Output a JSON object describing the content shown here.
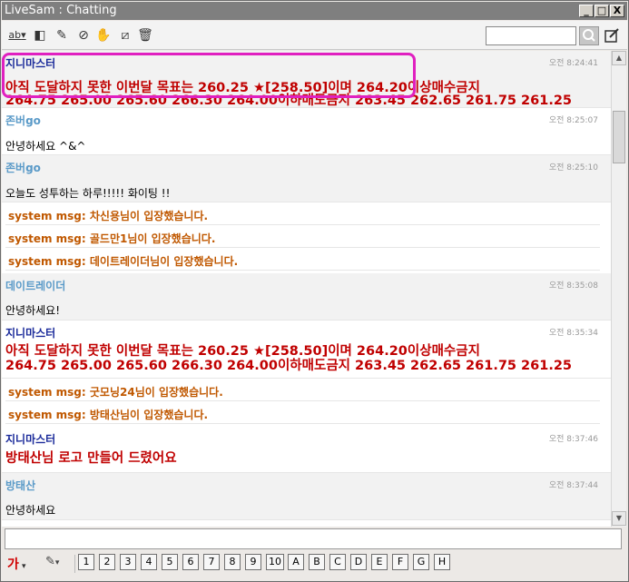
{
  "window": {
    "title": "LiveSam : Chatting",
    "min_label": "_",
    "max_label": "□",
    "close_label": "X"
  },
  "toolbar": {
    "ab_label": "ab",
    "search_placeholder": "",
    "icons": [
      "text-style-icon",
      "layout-icon",
      "eraser-icon",
      "block-icon",
      "mute-icon",
      "hide-icon",
      "trash-icon",
      "search-icon",
      "edit-icon"
    ]
  },
  "chat": {
    "messages": [
      {
        "name": "지니마스터",
        "time": "오전 8:24:41",
        "lines": [
          "아직 도달하지 못한 이번달 목표는 260.25 ★[258.50]이며 264.20이상매수금지",
          "264.75 265.00 265.60 266.30 264.00이하매도금지 263.45 262.65 261.75 261.25"
        ]
      },
      {
        "name": "존버go",
        "time": "오전 8:25:07",
        "text": "안녕하세요 ^&^"
      },
      {
        "name": "존버go",
        "time": "오전 8:25:10",
        "text": "오늘도 성투하는 하루!!!!! 화이팅 !!"
      },
      {
        "system": "system msg: 차신용님이 입장했습니다."
      },
      {
        "system": "system msg: 골드만1님이 입장했습니다."
      },
      {
        "system": "system msg: 데이트레이더님이 입장했습니다."
      },
      {
        "name": "데이트레이더",
        "time": "오전 8:35:08",
        "text": "안녕하세요!"
      },
      {
        "name": "지니마스터",
        "time": "오전 8:35:34",
        "lines": [
          "아직 도달하지 못한 이번달 목표는 260.25 ★[258.50]이며 264.20이상매수금지",
          "264.75 265.00 265.60 266.30 264.00이하매도금지 263.45 262.65 261.75 261.25"
        ]
      },
      {
        "system": "system msg: 굿모닝24님이 입장했습니다."
      },
      {
        "system": "system msg: 방태산님이 입장했습니다."
      },
      {
        "name": "지니마스터",
        "time": "오전 8:37:46",
        "big": "방태산님 로고 만들어 드렸어요"
      },
      {
        "name": "방태산",
        "time": "오전 8:37:44",
        "text": "안녕하세요"
      }
    ]
  },
  "input": {
    "value": ""
  },
  "bottombar": {
    "font_label": "가",
    "pen_label": "✎",
    "quick_buttons": [
      "1",
      "2",
      "3",
      "4",
      "5",
      "6",
      "7",
      "8",
      "9",
      "10",
      "A",
      "B",
      "C",
      "D",
      "E",
      "F",
      "G",
      "H"
    ]
  },
  "colors": {
    "master_name": "#1a2a9a",
    "user_name": "#5a9ac8",
    "big_text": "#c00000",
    "system_text": "#c05800",
    "highlight_border": "#e020c0"
  }
}
